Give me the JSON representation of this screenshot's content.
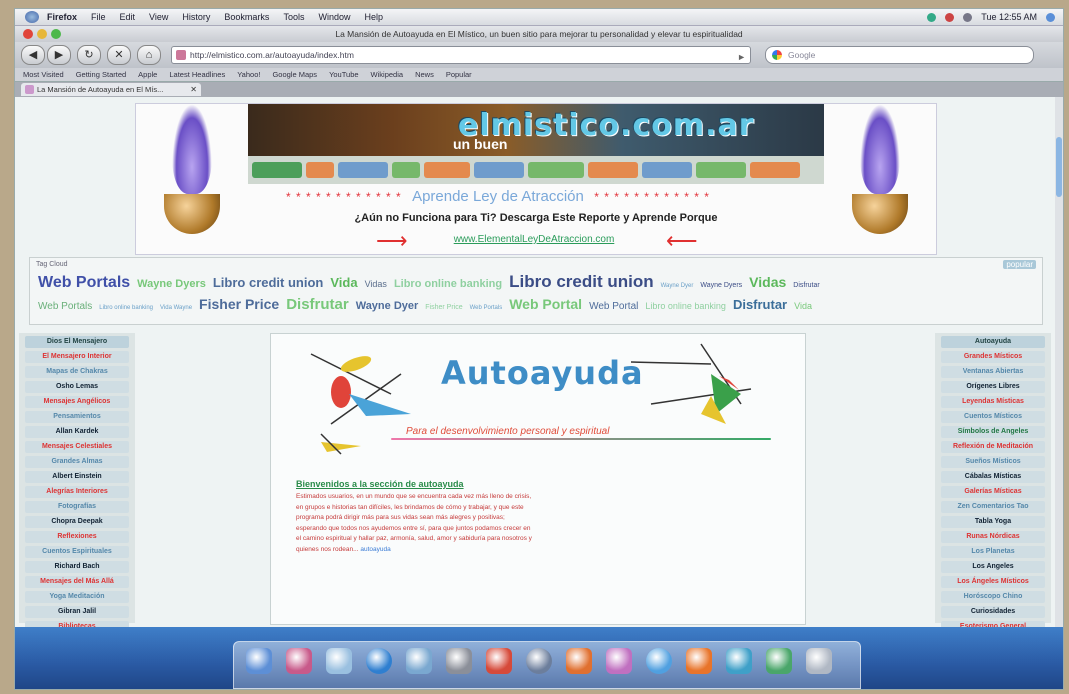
{
  "menubar": {
    "app": "Firefox",
    "items": [
      "File",
      "Edit",
      "View",
      "History",
      "Bookmarks",
      "Tools",
      "Window",
      "Help"
    ],
    "clock": "Tue 12:55 AM"
  },
  "window": {
    "title": "La Mansión de Autoayuda en El Místico, un buen sitio para mejorar tu personalidad y elevar tu espiritualidad"
  },
  "toolbar": {
    "url": "http://elmistico.com.ar/autoayuda/index.htm",
    "search_placeholder": "Google"
  },
  "bookmarks": [
    "Most Visited",
    "Getting Started",
    "Apple",
    "Latest Headlines",
    "Yahoo!",
    "Google Maps",
    "YouTube",
    "Wikipedia",
    "News",
    "Popular"
  ],
  "tab": {
    "label": "La Mansión de Autoayuda en El Mís..."
  },
  "page": {
    "banner_domain": "elmistico.com.ar",
    "banner_sub": "un buen",
    "stars": "* * * * * * * * * * * *",
    "aprende": "Aprende Ley de Atracción",
    "nofunciona": "¿Aún no Funciona para Ti? Descarga Este Reporte y Aprende Porque",
    "ad_link": "www.ElementalLeyDeAtraccion.com",
    "tagcloud_label": "Tag Cloud",
    "tagcloud_toggle": "popular",
    "tags_row1": [
      {
        "t": "Web Portals",
        "s": 16,
        "c": "#4050a8"
      },
      {
        "t": "Wayne Dyers",
        "s": 11,
        "c": "#78c87a"
      },
      {
        "t": "Libro credit union",
        "s": 13,
        "c": "#4e6c9a"
      },
      {
        "t": "Vida",
        "s": 13,
        "c": "#5bb85b"
      },
      {
        "t": "Vidas",
        "s": 9,
        "c": "#5a6e8c"
      },
      {
        "t": "Libro online banking",
        "s": 11,
        "c": "#8fd0a0"
      },
      {
        "t": "Libro credit union",
        "s": 17,
        "c": "#3b4d86"
      },
      {
        "t": "Wayne Dyer",
        "s": 6,
        "c": "#6aa0c8"
      },
      {
        "t": "Wayne Dyers",
        "s": 7,
        "c": "#3b4d86"
      },
      {
        "t": "Vidas",
        "s": 14,
        "c": "#5bb85b"
      },
      {
        "t": "Disfrutar",
        "s": 7,
        "c": "#3b4d86"
      }
    ],
    "tags_row2": [
      {
        "t": "Web Portals",
        "s": 10,
        "c": "#6ab07a"
      },
      {
        "t": "Libro online banking",
        "s": 6,
        "c": "#6aa0c8"
      },
      {
        "t": "Vida Wayne",
        "s": 6,
        "c": "#6aa0c8"
      },
      {
        "t": "Fisher Price",
        "s": 14,
        "c": "#4e6c9a"
      },
      {
        "t": "Disfrutar",
        "s": 15,
        "c": "#78c87a"
      },
      {
        "t": "Wayne Dyer",
        "s": 11,
        "c": "#4e6c9a"
      },
      {
        "t": "Fisher Price",
        "s": 7,
        "c": "#8fd0a0"
      },
      {
        "t": "Web Portals",
        "s": 6,
        "c": "#6aa0c8"
      },
      {
        "t": "Web Portal",
        "s": 14,
        "c": "#78c87a"
      },
      {
        "t": "Web Portal",
        "s": 10,
        "c": "#4e6c9a"
      },
      {
        "t": "Libro online banking",
        "s": 9,
        "c": "#8fd0a0"
      },
      {
        "t": "Disfrutar",
        "s": 13,
        "c": "#3b6e9a"
      },
      {
        "t": "Vida",
        "s": 9,
        "c": "#78c87a"
      }
    ],
    "left_menu": [
      {
        "t": "Dios El Mensajero",
        "k": "head"
      },
      {
        "t": "El Mensajero Interior",
        "k": "red"
      },
      {
        "t": "Mapas de Chakras",
        "k": "blue"
      },
      {
        "t": "Osho Lemas",
        "k": "dark"
      },
      {
        "t": "Mensajes Angélicos",
        "k": "red"
      },
      {
        "t": "Pensamientos",
        "k": "blue"
      },
      {
        "t": "Allan Kardek",
        "k": "dark"
      },
      {
        "t": "Mensajes Celestiales",
        "k": "red"
      },
      {
        "t": "Grandes Almas",
        "k": "blue"
      },
      {
        "t": "Albert Einstein",
        "k": "dark"
      },
      {
        "t": "Alegrías Interiores",
        "k": "red"
      },
      {
        "t": "Fotografías",
        "k": "blue"
      },
      {
        "t": "Chopra Deepak",
        "k": "dark"
      },
      {
        "t": "Reflexiones",
        "k": "red"
      },
      {
        "t": "Cuentos Espirituales",
        "k": "blue"
      },
      {
        "t": "Richard Bach",
        "k": "dark"
      },
      {
        "t": "Mensajes del Más Allá",
        "k": "red"
      },
      {
        "t": "Yoga Meditación",
        "k": "blue"
      },
      {
        "t": "Gibran Jalil",
        "k": "dark"
      },
      {
        "t": "Bibliotecas",
        "k": "red"
      }
    ],
    "right_menu": [
      {
        "t": "Autoayuda",
        "k": "head"
      },
      {
        "t": "Grandes Místicos",
        "k": "red"
      },
      {
        "t": "Ventanas Abiertas",
        "k": "blue"
      },
      {
        "t": "Orígenes Libres",
        "k": "dark"
      },
      {
        "t": "Leyendas Místicas",
        "k": "red"
      },
      {
        "t": "Cuentos Místicos",
        "k": "blue"
      },
      {
        "t": "Símbolos de Angeles",
        "k": "green"
      },
      {
        "t": "Reflexión de Meditación",
        "k": "red"
      },
      {
        "t": "Sueños Místicos",
        "k": "blue"
      },
      {
        "t": "Cábalas Místicas",
        "k": "dark"
      },
      {
        "t": "Galerías Místicas",
        "k": "red"
      },
      {
        "t": "Zen Comentarios Tao",
        "k": "blue"
      },
      {
        "t": "Tabla Yoga",
        "k": "dark"
      },
      {
        "t": "Runas Nórdicas",
        "k": "red"
      },
      {
        "t": "Los Planetas",
        "k": "blue"
      },
      {
        "t": "Los Angeles",
        "k": "dark"
      },
      {
        "t": "Los Ángeles Místicos",
        "k": "red"
      },
      {
        "t": "Horóscopo Chino",
        "k": "blue"
      },
      {
        "t": "Curiosidades",
        "k": "dark"
      },
      {
        "t": "Esoterismo General",
        "k": "red"
      }
    ],
    "center_title": "Autoayuda",
    "center_slogan": "Para el desenvolvimiento personal y espiritual",
    "article_title": "Bienvenidos a la sección de autoayuda",
    "article_text": "Estimados usuarios, en un mundo que se encuentra cada vez más lleno de crisis, en grupos e historias tan difíciles, les brindamos de cómo y trabajar, y que este programa podrá dirigir más para sus vidas sean más alegres y positivas; esperando que todos nos ayudemos entre sí, para que juntos podamos crecer en el camino espiritual y hallar paz, armonía, salud, amor y sabiduría para nosotros y quienes nos rodean...",
    "article_link": "autoayuda"
  },
  "colors": {
    "dock_blue": "#2a5aa4",
    "link_green": "#2a9c5a",
    "accent_red": "#e3343c",
    "title_blue": "#3e8dc6"
  },
  "dock_icons": [
    "finder-icon",
    "preview-icon",
    "ichat-icon",
    "safari-icon",
    "mail-icon",
    "system-prefs-icon",
    "acrobat-icon",
    "itunes-icon",
    "photoshop-icon",
    "dreamweaver-icon",
    "firefox-icon",
    "network-icon",
    "adium-icon",
    "documents-icon",
    "trash-icon"
  ]
}
